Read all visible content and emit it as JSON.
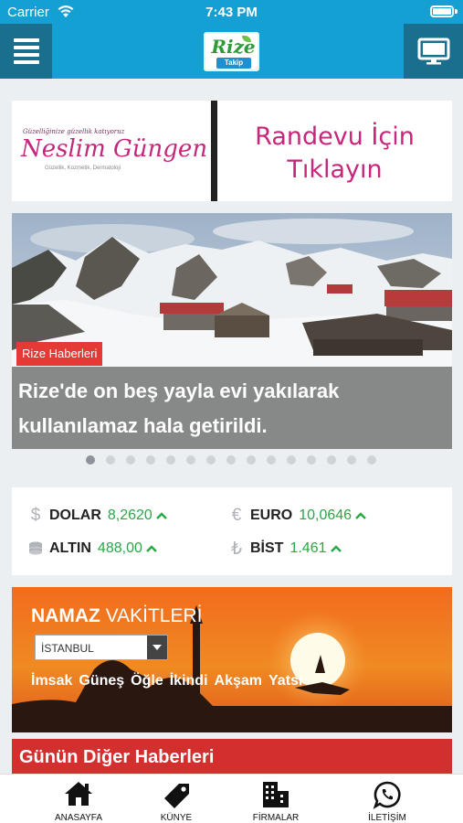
{
  "status_bar": {
    "carrier": "Carrier",
    "time": "7:43 PM"
  },
  "header": {
    "logo_text": "Rize",
    "logo_sub": "Takip"
  },
  "ad": {
    "tagline": "Güzelliğinize güzellik katıyoruz",
    "brand": "Neslim Güngen",
    "small_text": "Güzellik, Kozmetik, Dermatoloji",
    "cta_line1": "Randevu İçin",
    "cta_line2": "Tıklayın"
  },
  "slider": {
    "category": "Rize Haberleri",
    "caption": "Rize'de on beş yayla evi yakılarak kullanılamaz hala getirildi.",
    "dot_count": 15,
    "active_index": 0
  },
  "market": {
    "items": [
      {
        "icon": "dollar-icon",
        "symbol": "$",
        "name": "DOLAR",
        "value": "8,2620",
        "trend": "up"
      },
      {
        "icon": "euro-icon",
        "symbol": "€",
        "name": "EURO",
        "value": "10,0646",
        "trend": "up"
      },
      {
        "icon": "gold-icon",
        "symbol": "≡",
        "name": "ALTIN",
        "value": "488,00",
        "trend": "up"
      },
      {
        "icon": "lira-icon",
        "symbol": "₺",
        "name": "BİST",
        "value": "1.461",
        "trend": "up"
      }
    ]
  },
  "prayer": {
    "title_bold": "NAMAZ",
    "title_rest": "VAKİTLERİ",
    "city": "İSTANBUL",
    "times": [
      "İmsak",
      "Güneş",
      "Öğle",
      "İkindi",
      "Akşam",
      "Yatsı"
    ]
  },
  "other_news": {
    "title": "Günün Diğer Haberleri"
  },
  "tabs": [
    {
      "icon": "home-icon",
      "label": "ANASAYFA"
    },
    {
      "icon": "tag-icon",
      "label": "KÜNYE"
    },
    {
      "icon": "buildings-icon",
      "label": "FİRMALAR"
    },
    {
      "icon": "whatsapp-icon",
      "label": "İLETİŞİM"
    }
  ],
  "colors": {
    "header": "#15a0d3",
    "header_button": "#1a6f8e",
    "accent_red": "#d32f2f",
    "up_green": "#27a845",
    "ad_pink": "#c4277b"
  }
}
